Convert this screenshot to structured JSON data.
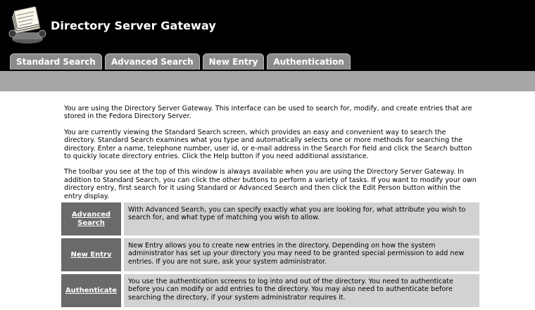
{
  "app": {
    "title": "Directory Server Gateway"
  },
  "tabs": [
    {
      "label": "Standard Search"
    },
    {
      "label": "Advanced Search"
    },
    {
      "label": "New Entry"
    },
    {
      "label": "Authentication"
    }
  ],
  "intro": {
    "p1": "You are using the Directory Server Gateway. This interface can be used to search for, modify, and create entries that are stored in the Fedora Directory Server.",
    "p2": "You are currently viewing the Standard Search screen, which provides an easy and convenient way to search the directory. Standard Search examines what you type and automatically selects one or more methods for searching the directory. Enter a name, telephone number, user id, or e-mail address in the Search For field and click the Search button to quickly locate directory entries. Click the Help button if you need additional assistance.",
    "p3": "The toolbar you see at the top of this window is always available when you are using the Directory Server Gateway. In addition to Standard Search, you can click the other buttons to perform a variety of tasks. If you want to modify your own directory entry, first search for it using Standard or Advanced Search and then click the Edit Person button within the entry display."
  },
  "features": [
    {
      "link": "Advanced Search",
      "description": "With Advanced Search, you can specify exactly what you are looking for, what attribute you wish to search for, and what type of matching you wish to allow."
    },
    {
      "link": "New Entry",
      "description": "New Entry allows you to create new entries in the directory. Depending on how the system administrator has set up your directory you may need to be granted special permission to add new entries. If you are not sure, ask your system administrator."
    },
    {
      "link": "Authenticate",
      "description": "You use the authentication screens to log into and out of the directory. You need to authenticate before you can modify or add entries to the directory. You may also need to authenticate before searching the directory, if your system administrator requires it."
    }
  ],
  "icons": {
    "logo": "rolodex-card-file-icon"
  },
  "colors": {
    "header_bg": "#000000",
    "tab_bg": "#8c8c8c",
    "subbar_bg": "#a6a6a6",
    "link_cell_bg": "#6a6a6a",
    "desc_cell_bg": "#d2d2d2"
  }
}
